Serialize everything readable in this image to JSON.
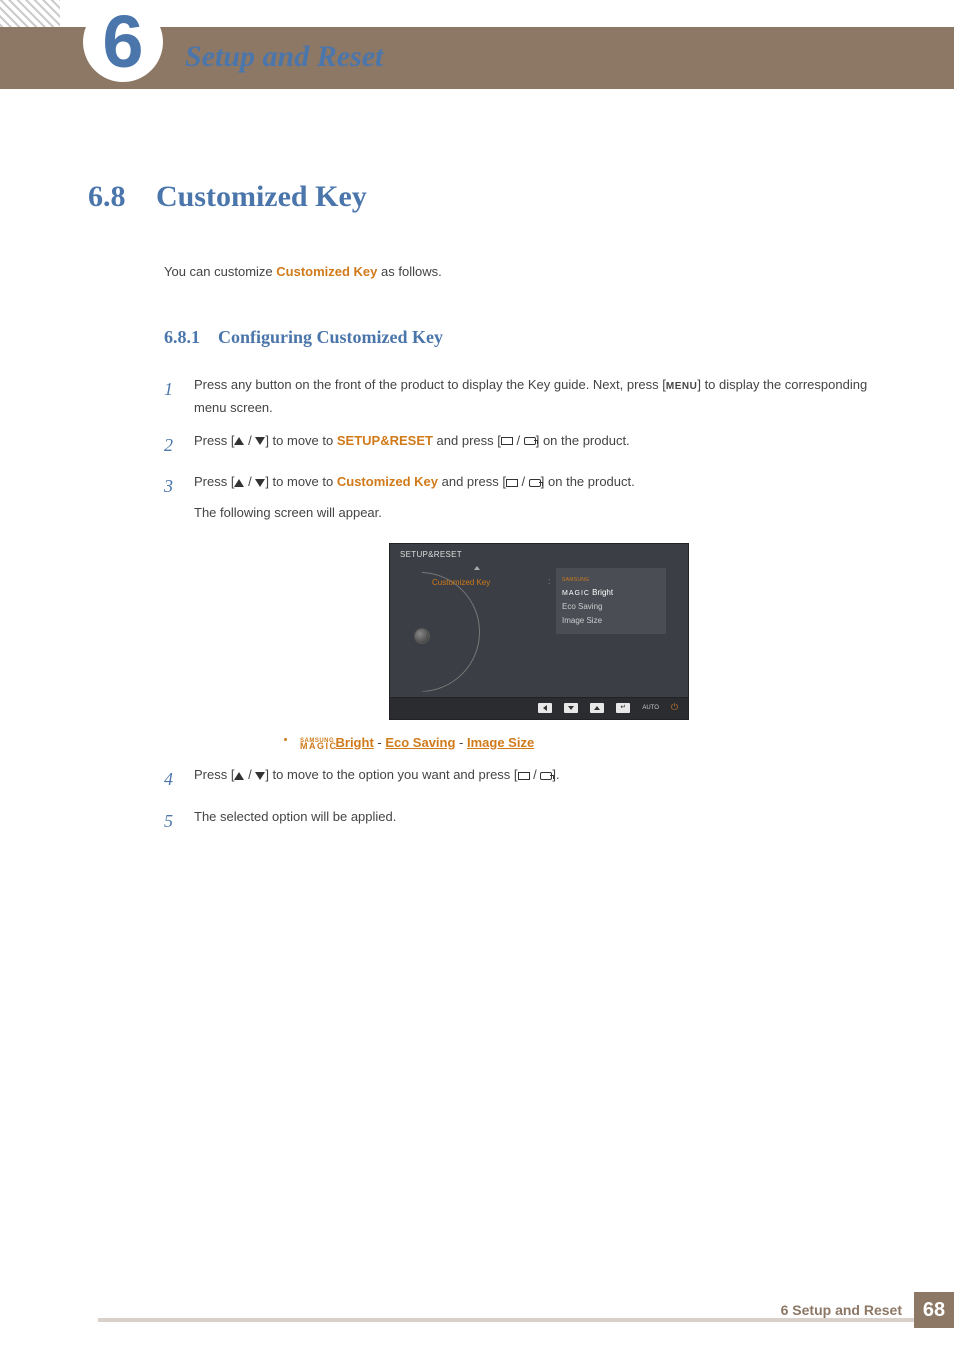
{
  "chapter": {
    "number": "6",
    "title": "Setup and Reset"
  },
  "section": {
    "number": "6.8",
    "title": "Customized Key",
    "intro_pre": "You can customize ",
    "intro_hl": "Customized Key",
    "intro_post": " as follows."
  },
  "subsection": {
    "number": "6.8.1",
    "title": "Configuring Customized Key"
  },
  "steps": {
    "s1": {
      "num": "1",
      "a": "Press any button on the front of the product to display the Key guide. Next, press [",
      "menu": "MENU",
      "b": "] to display the corresponding menu screen."
    },
    "s2": {
      "num": "2",
      "a": "Press [",
      "b": "] to move to ",
      "hl": "SETUP&RESET",
      "c": " and press [",
      "d": "] on the product."
    },
    "s3": {
      "num": "3",
      "a": "Press [",
      "b": "] to move to ",
      "hl": "Customized Key",
      "c": " and press [",
      "d": "] on the product.",
      "sub": "The following screen will appear."
    },
    "s4": {
      "num": "4",
      "a": "Press [",
      "b": "] to move to the option you want and press [",
      "c": "]."
    },
    "s5": {
      "num": "5",
      "text": "The selected option will be applied."
    }
  },
  "osd": {
    "title": "SETUP&RESET",
    "item": "Customized Key",
    "opt_prefix": "SAMSUNG",
    "opt_magic": "MAGIC",
    "opt1_suffix": " Bright",
    "opt2": "Eco Saving",
    "opt3": "Image Size",
    "auto": "AUTO"
  },
  "bullet": {
    "prefix_sm": "SAMSUNG",
    "prefix_lg": "MAGIC",
    "link1": "Bright",
    "sep": " - ",
    "link2": "Eco Saving",
    "link3": "Image Size"
  },
  "footer": {
    "text": "6 Setup and Reset",
    "page": "68"
  }
}
